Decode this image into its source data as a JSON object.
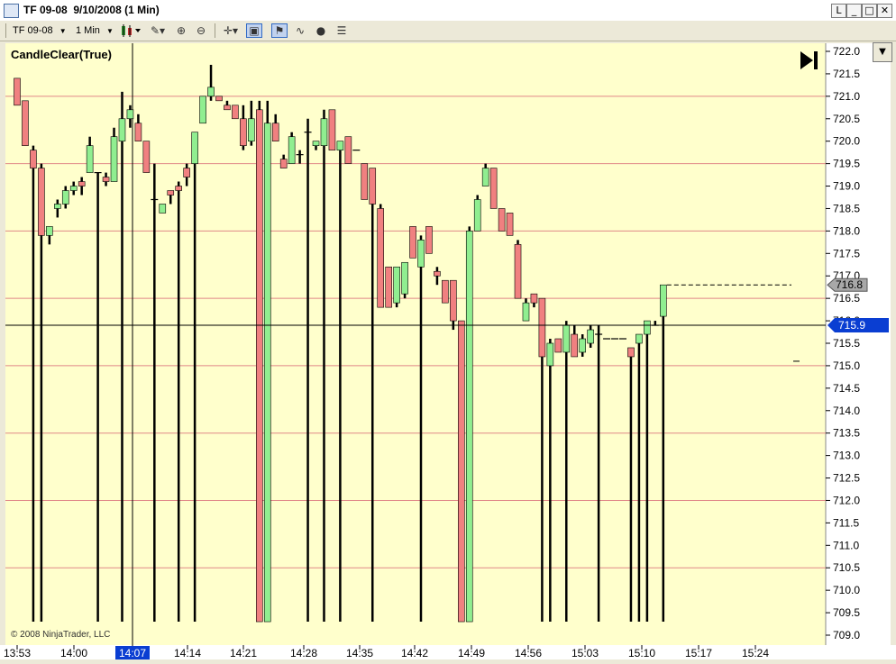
{
  "window": {
    "title": "TF 09-08  9/10/2008 (1 Min)",
    "controls": [
      "L",
      "_",
      "□",
      "✕"
    ]
  },
  "toolbar": {
    "instrument": "TF 09-08",
    "interval": "1 Min"
  },
  "chart": {
    "indicator_label": "CandleClear(True)",
    "copyright": "© 2008 NinjaTrader, LLC",
    "last_price_label": "715.9",
    "marker_price_label": "716.8",
    "highlighted_time": "14:07"
  },
  "chart_data": {
    "type": "candlestick",
    "title": "",
    "instrument": "TF 09-08",
    "interval": "1 Min",
    "date": "9/10/2008",
    "ylim": [
      709.0,
      722.0
    ],
    "y_ticks": [
      "722.0",
      "721.5",
      "721.0",
      "720.5",
      "720.0",
      "719.5",
      "719.0",
      "718.5",
      "718.0",
      "717.5",
      "717.0",
      "716.5",
      "716.0",
      "715.5",
      "715.0",
      "714.5",
      "714.0",
      "713.5",
      "713.0",
      "712.5",
      "712.0",
      "711.5",
      "711.0",
      "710.5",
      "710.0",
      "709.5",
      "709.0"
    ],
    "x_ticks": [
      "13:53",
      "14:00",
      "14:07",
      "14:14",
      "14:21",
      "14:28",
      "14:35",
      "14:42",
      "14:49",
      "14:56",
      "15:03",
      "15:10",
      "15:17",
      "15:24"
    ],
    "grid": "horizontal lines every 1.5 points",
    "colors": {
      "background": "#ffffcc",
      "up": "#90ee90",
      "down": "#f08080",
      "wick": "#000000",
      "grid": "#e08888",
      "last_price": "#0a3ed2"
    },
    "last_price": 715.9,
    "marker_price": 716.8,
    "candles": [
      {
        "o": 721.4,
        "h": 721.4,
        "l": 720.8,
        "c": 720.8
      },
      {
        "o": 720.9,
        "h": 720.9,
        "l": 719.9,
        "c": 719.9
      },
      {
        "o": 719.8,
        "h": 719.9,
        "l": 709.3,
        "c": 719.4
      },
      {
        "o": 719.4,
        "h": 719.5,
        "l": 709.3,
        "c": 717.9
      },
      {
        "o": 717.9,
        "h": 718.1,
        "l": 717.7,
        "c": 718.1
      },
      {
        "o": 718.5,
        "h": 718.7,
        "l": 718.3,
        "c": 718.6
      },
      {
        "o": 718.6,
        "h": 719.0,
        "l": 718.5,
        "c": 718.9
      },
      {
        "o": 718.9,
        "h": 719.1,
        "l": 718.8,
        "c": 719.0
      },
      {
        "o": 719.1,
        "h": 719.2,
        "l": 718.8,
        "c": 719.0
      },
      {
        "o": 719.3,
        "h": 720.1,
        "l": 719.3,
        "c": 719.9
      },
      {
        "o": 719.3,
        "h": 719.3,
        "l": 709.3,
        "c": 719.3
      },
      {
        "o": 719.2,
        "h": 719.3,
        "l": 719.0,
        "c": 719.1
      },
      {
        "o": 719.1,
        "h": 720.3,
        "l": 719.1,
        "c": 720.1
      },
      {
        "o": 720.0,
        "h": 721.1,
        "l": 709.3,
        "c": 720.5
      },
      {
        "o": 720.5,
        "h": 720.8,
        "l": 720.3,
        "c": 720.7
      },
      {
        "o": 720.4,
        "h": 720.6,
        "l": 720.0,
        "c": 720.0
      },
      {
        "o": 720.0,
        "h": 720.0,
        "l": 719.3,
        "c": 719.3
      },
      {
        "o": 718.7,
        "h": 719.5,
        "l": 709.3,
        "c": 718.7
      },
      {
        "o": 718.4,
        "h": 718.6,
        "l": 718.4,
        "c": 718.6
      },
      {
        "o": 718.9,
        "h": 718.9,
        "l": 718.6,
        "c": 718.8
      },
      {
        "o": 719.0,
        "h": 719.1,
        "l": 709.3,
        "c": 718.9
      },
      {
        "o": 719.4,
        "h": 719.5,
        "l": 719.0,
        "c": 719.2
      },
      {
        "o": 719.5,
        "h": 720.2,
        "l": 709.3,
        "c": 720.2
      },
      {
        "o": 720.4,
        "h": 721.0,
        "l": 720.4,
        "c": 721.0
      },
      {
        "o": 721.0,
        "h": 721.7,
        "l": 720.9,
        "c": 721.2
      },
      {
        "o": 721.0,
        "h": 721.0,
        "l": 720.9,
        "c": 720.9
      },
      {
        "o": 720.8,
        "h": 720.9,
        "l": 720.7,
        "c": 720.7
      },
      {
        "o": 720.8,
        "h": 720.8,
        "l": 720.5,
        "c": 720.5
      },
      {
        "o": 720.5,
        "h": 720.8,
        "l": 719.8,
        "c": 719.9
      },
      {
        "o": 720.0,
        "h": 720.9,
        "l": 719.9,
        "c": 720.5
      },
      {
        "o": 720.7,
        "h": 720.9,
        "l": 709.3,
        "c": 709.3
      },
      {
        "o": 709.3,
        "h": 720.9,
        "l": 709.3,
        "c": 720.4
      },
      {
        "o": 720.4,
        "h": 720.6,
        "l": 720.0,
        "c": 720.0
      },
      {
        "o": 719.6,
        "h": 719.7,
        "l": 719.4,
        "c": 719.4
      },
      {
        "o": 719.5,
        "h": 720.2,
        "l": 719.5,
        "c": 720.1
      },
      {
        "o": 719.7,
        "h": 719.8,
        "l": 719.5,
        "c": 719.7
      },
      {
        "o": 720.2,
        "h": 720.5,
        "l": 709.3,
        "c": 720.2
      },
      {
        "o": 719.9,
        "h": 720.0,
        "l": 719.8,
        "c": 720.0
      },
      {
        "o": 719.9,
        "h": 720.7,
        "l": 709.3,
        "c": 720.5
      },
      {
        "o": 720.7,
        "h": 720.7,
        "l": 719.8,
        "c": 719.8
      },
      {
        "o": 719.8,
        "h": 720.0,
        "l": 709.3,
        "c": 720.0
      },
      {
        "o": 720.1,
        "h": 720.1,
        "l": 719.5,
        "c": 719.5
      },
      {
        "o": 719.8,
        "h": 719.8,
        "l": 719.8,
        "c": 719.8
      },
      {
        "o": 719.5,
        "h": 719.5,
        "l": 718.7,
        "c": 718.7
      },
      {
        "o": 719.4,
        "h": 719.4,
        "l": 709.3,
        "c": 718.6
      },
      {
        "o": 718.5,
        "h": 718.6,
        "l": 716.3,
        "c": 716.3
      },
      {
        "o": 717.2,
        "h": 717.2,
        "l": 716.3,
        "c": 716.3
      },
      {
        "o": 716.4,
        "h": 717.2,
        "l": 716.3,
        "c": 717.2
      },
      {
        "o": 716.6,
        "h": 717.3,
        "l": 716.5,
        "c": 717.3
      },
      {
        "o": 718.1,
        "h": 718.1,
        "l": 717.4,
        "c": 717.4
      },
      {
        "o": 717.2,
        "h": 717.9,
        "l": 709.3,
        "c": 717.8
      },
      {
        "o": 718.1,
        "h": 718.1,
        "l": 717.5,
        "c": 717.5
      },
      {
        "o": 717.1,
        "h": 717.2,
        "l": 716.8,
        "c": 717.0
      },
      {
        "o": 716.9,
        "h": 716.9,
        "l": 716.4,
        "c": 716.4
      },
      {
        "o": 716.9,
        "h": 716.9,
        "l": 715.8,
        "c": 716.0
      },
      {
        "o": 716.0,
        "h": 716.0,
        "l": 709.3,
        "c": 709.3
      },
      {
        "o": 709.3,
        "h": 718.1,
        "l": 709.3,
        "c": 718.0
      },
      {
        "o": 718.0,
        "h": 718.8,
        "l": 718.0,
        "c": 718.7
      },
      {
        "o": 719.0,
        "h": 719.5,
        "l": 719.0,
        "c": 719.4
      },
      {
        "o": 719.4,
        "h": 719.4,
        "l": 718.5,
        "c": 718.5
      },
      {
        "o": 718.5,
        "h": 718.5,
        "l": 718.0,
        "c": 718.0
      },
      {
        "o": 718.4,
        "h": 718.4,
        "l": 717.9,
        "c": 717.9
      },
      {
        "o": 717.7,
        "h": 717.8,
        "l": 716.5,
        "c": 716.5
      },
      {
        "o": 716.0,
        "h": 716.5,
        "l": 716.0,
        "c": 716.4
      },
      {
        "o": 716.6,
        "h": 716.6,
        "l": 716.3,
        "c": 716.4
      },
      {
        "o": 716.5,
        "h": 716.5,
        "l": 709.3,
        "c": 715.2
      },
      {
        "o": 715.0,
        "h": 715.6,
        "l": 709.3,
        "c": 715.5
      },
      {
        "o": 715.6,
        "h": 715.6,
        "l": 715.3,
        "c": 715.3
      },
      {
        "o": 715.3,
        "h": 716.0,
        "l": 709.3,
        "c": 715.9
      },
      {
        "o": 715.7,
        "h": 715.9,
        "l": 715.2,
        "c": 715.2
      },
      {
        "o": 715.3,
        "h": 715.7,
        "l": 715.2,
        "c": 715.6
      },
      {
        "o": 715.5,
        "h": 715.9,
        "l": 715.4,
        "c": 715.8
      },
      {
        "o": 715.7,
        "h": 715.9,
        "l": 709.3,
        "c": 715.7
      },
      {
        "o": 715.6,
        "h": 715.6,
        "l": 715.6,
        "c": 715.6
      },
      {
        "o": 715.6,
        "h": 715.6,
        "l": 715.6,
        "c": 715.6
      },
      {
        "o": 715.6,
        "h": 715.6,
        "l": 715.6,
        "c": 715.6
      },
      {
        "o": 715.4,
        "h": 715.4,
        "l": 709.3,
        "c": 715.2
      },
      {
        "o": 715.5,
        "h": 715.7,
        "l": 709.3,
        "c": 715.7
      },
      {
        "o": 715.7,
        "h": 716.0,
        "l": 709.3,
        "c": 716.0
      },
      {
        "o": 715.9,
        "h": 716.0,
        "l": 715.9,
        "c": 715.9
      },
      {
        "o": 716.1,
        "h": 716.8,
        "l": 709.3,
        "c": 716.8
      }
    ]
  }
}
